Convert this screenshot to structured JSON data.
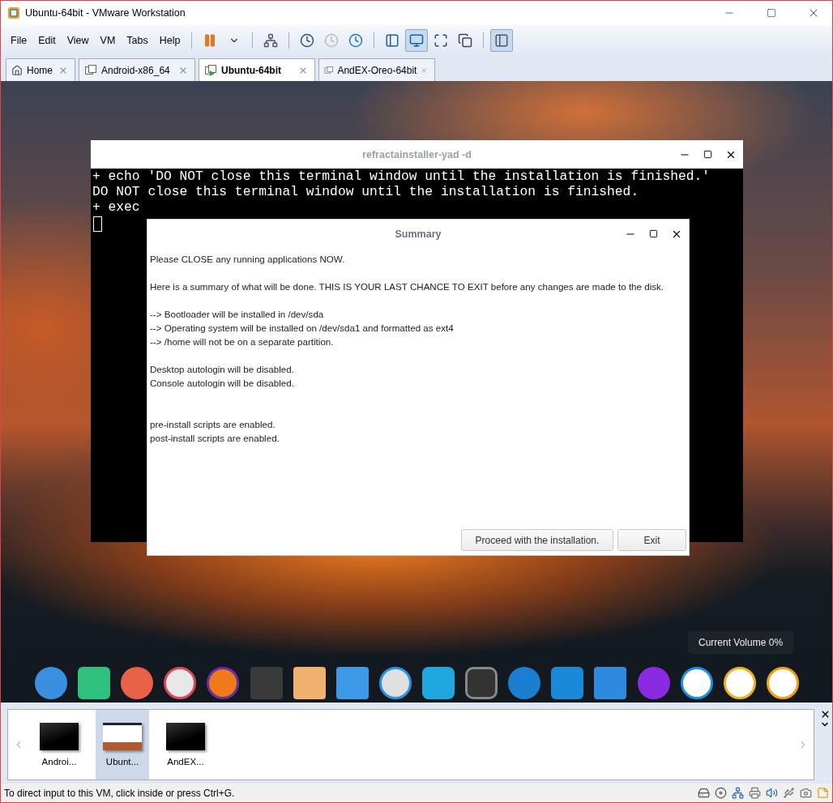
{
  "window": {
    "title": "Ubuntu-64bit - VMware Workstation"
  },
  "menu": [
    "File",
    "Edit",
    "View",
    "VM",
    "Tabs",
    "Help"
  ],
  "view_buttons": [
    {
      "selected": false
    },
    {
      "selected": true
    },
    {
      "selected": false
    },
    {
      "selected": false
    }
  ],
  "library_button": {
    "selected": true
  },
  "tabs": [
    {
      "label": "Home",
      "kind": "home",
      "selected": false
    },
    {
      "label": "Android-x86_64",
      "kind": "vm",
      "selected": false
    },
    {
      "label": "Ubuntu-64bit",
      "kind": "vm",
      "selected": true
    },
    {
      "label": "AndEX-Oreo-64bit",
      "kind": "vm",
      "selected": false
    }
  ],
  "terminal": {
    "title": "refractainstaller-yad -d",
    "lines": [
      "+ echo 'DO NOT close this terminal window until the installation is finished.'",
      "DO NOT close this terminal window until the installation is finished.",
      "+ exec"
    ]
  },
  "dialog": {
    "title": "Summary",
    "paragraphs": [
      [
        "Please CLOSE any running applications NOW."
      ],
      [
        "Here is a summary of what will be done. THIS IS YOUR LAST CHANCE TO EXIT before any changes are made to the disk."
      ],
      [
        "--> Bootloader will be installed in /dev/sda",
        "--> Operating system will be installed on /dev/sda1 and formatted as ext4",
        "--> /home will not be on a separate partition."
      ],
      [
        "Desktop autologin will be disabled.",
        "Console autologin will be disabled."
      ],
      [
        "pre-install scripts are enabled.",
        "post-install scripts are enabled."
      ]
    ],
    "buttons": [
      "Proceed with the installation.",
      "Exit"
    ]
  },
  "tooltip": "Current Volume 0%",
  "thumbnails": [
    {
      "label": "Androi...",
      "kind": "blank",
      "selected": false
    },
    {
      "label": "Ubunt...",
      "kind": "desktop",
      "selected": true
    },
    {
      "label": "AndEX...",
      "kind": "blank",
      "selected": false
    }
  ],
  "status_bar": {
    "text": "To direct input to this VM, click inside or press Ctrl+G."
  }
}
